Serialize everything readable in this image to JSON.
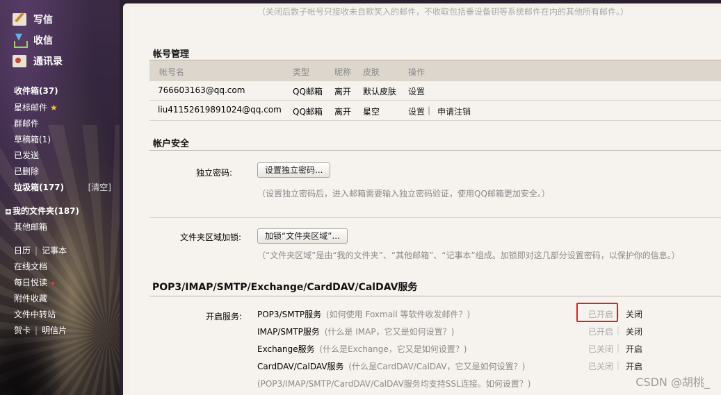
{
  "sidebar": {
    "write_label": "写信",
    "receive_label": "收信",
    "contacts_label": "通讯录",
    "inbox": "收件箱(37)",
    "starred": "星标邮件",
    "group": "群邮件",
    "drafts": "草稿箱(1)",
    "sent": "已发送",
    "deleted": "已删除",
    "spam": "垃圾箱(177)",
    "spam_clear": "[清空]",
    "my_folders": "我的文件夹(187)",
    "other_mail": "其他邮箱",
    "calendar": "日历",
    "notes": "记事本",
    "online_docs": "在线文档",
    "daily_reading": "每日悦读",
    "attachments": "附件收藏",
    "file_transfer": "文件中转站",
    "greeting_card": "贺卡",
    "postcard": "明信片"
  },
  "top_note": "（关闭后数子帐号只接收未自欺笑入的邮件，不收取包括垂设备钥等系统邮件在内的其他所有邮件。）",
  "accounts": {
    "title": "帐号管理",
    "headers": [
      "帐号名",
      "类型",
      "昵称",
      "皮肤",
      "操作"
    ],
    "rows": [
      {
        "name": "766603163@qq.com",
        "type": "QQ邮箱",
        "nick": "离开",
        "skin": "默认皮肤",
        "op1": "设置",
        "op2": ""
      },
      {
        "name": "liu41152619891024@qq.com",
        "type": "QQ邮箱",
        "nick": "离开",
        "skin": "星空",
        "op1": "设置",
        "op2": "申请注销"
      }
    ]
  },
  "security": {
    "title": "帐户安全",
    "pwd_label": "独立密码:",
    "pwd_button": "设置独立密码...",
    "pwd_note": "（设置独立密码后，进入邮箱需要输入独立密码验证，使用QQ邮箱更加安全。）",
    "lock_label": "文件夹区域加锁:",
    "lock_button": "加锁“文件夹区域”...",
    "lock_note": "（“文件夹区域”是由“我的文件夹”、“其他邮箱”、“记事本”组成。加锁即对这几部分设置密码，以保护你的信息。）"
  },
  "services": {
    "title": "POP3/IMAP/SMTP/Exchange/CardDAV/CalDAV服务",
    "label": "开启服务:",
    "items": [
      {
        "name": "POP3/SMTP服务",
        "hint": "(如何使用 Foxmail 等软件收发邮件？)",
        "on": "已开启",
        "off": "关闭"
      },
      {
        "name": "IMAP/SMTP服务",
        "hint": "(什么是 IMAP，它又是如何设置？)",
        "on": "已开启",
        "off": "关闭"
      },
      {
        "name": "Exchange服务",
        "hint": "(什么是Exchange，它又是如何设置？)",
        "on": "已关闭",
        "off": "开启"
      },
      {
        "name": "CardDAV/CalDAV服务",
        "hint": "(什么是CardDAV/CalDAV，它又是如何设置？)",
        "on": "已关闭",
        "off": "开启"
      }
    ],
    "footnote": "(POP3/IMAP/SMTP/CardDAV/CalDAV服务均支持SSL连接。如何设置？)"
  },
  "watermark": "CSDN @胡桃_",
  "colors": {
    "highlight": "#e02020",
    "panel": "#f6f3ee",
    "header_bar": "#dcd6cd"
  }
}
